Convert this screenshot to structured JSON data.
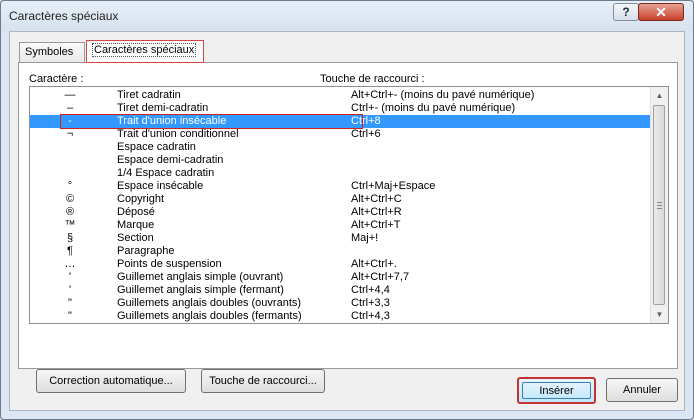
{
  "window": {
    "title": "Caractères spéciaux",
    "help_label": "?",
    "close_label": "✕"
  },
  "tabs": [
    {
      "label": "Symboles",
      "active": false
    },
    {
      "label": "Caractères spéciaux",
      "active": true
    }
  ],
  "list": {
    "header_char": "Caractère :",
    "header_key": "Touche de raccourci :",
    "selected_index": 2,
    "rows": [
      {
        "char": "—",
        "name": "Tiret cadratin",
        "key": "Alt+Ctrl+- (moins du pavé numérique)"
      },
      {
        "char": "–",
        "name": "Tiret demi-cadratin",
        "key": "Ctrl+- (moins du pavé numérique)"
      },
      {
        "char": "-",
        "name": "Trait d'union insécable",
        "key": "Ctrl+8"
      },
      {
        "char": "¬",
        "name": "Trait d'union conditionnel",
        "key": "Ctrl+6"
      },
      {
        "char": "",
        "name": "Espace cadratin",
        "key": ""
      },
      {
        "char": "",
        "name": "Espace demi-cadratin",
        "key": ""
      },
      {
        "char": "",
        "name": "1/4 Espace cadratin",
        "key": ""
      },
      {
        "char": "°",
        "name": "Espace insécable",
        "key": "Ctrl+Maj+Espace"
      },
      {
        "char": "©",
        "name": "Copyright",
        "key": "Alt+Ctrl+C"
      },
      {
        "char": "®",
        "name": "Déposé",
        "key": "Alt+Ctrl+R"
      },
      {
        "char": "™",
        "name": "Marque",
        "key": "Alt+Ctrl+T"
      },
      {
        "char": "§",
        "name": "Section",
        "key": "Maj+!"
      },
      {
        "char": "¶",
        "name": "Paragraphe",
        "key": ""
      },
      {
        "char": "…",
        "name": "Points de suspension",
        "key": "Alt+Ctrl+."
      },
      {
        "char": "'",
        "name": "Guillemet anglais simple (ouvrant)",
        "key": "Alt+Ctrl+7,7"
      },
      {
        "char": "'",
        "name": "Guillemet anglais simple (fermant)",
        "key": "Ctrl+4,4"
      },
      {
        "char": "\"",
        "name": "Guillemets anglais doubles (ouvrants)",
        "key": "Ctrl+3,3"
      },
      {
        "char": "\"",
        "name": "Guillemets anglais doubles (fermants)",
        "key": "Ctrl+4,3"
      }
    ]
  },
  "buttons": {
    "autocorrect": "Correction automatique...",
    "shortcut": "Touche de raccourci...",
    "insert": "Insérer",
    "cancel": "Annuler"
  },
  "scrollbar": {
    "up_icon": "▲",
    "down_icon": "▼"
  }
}
